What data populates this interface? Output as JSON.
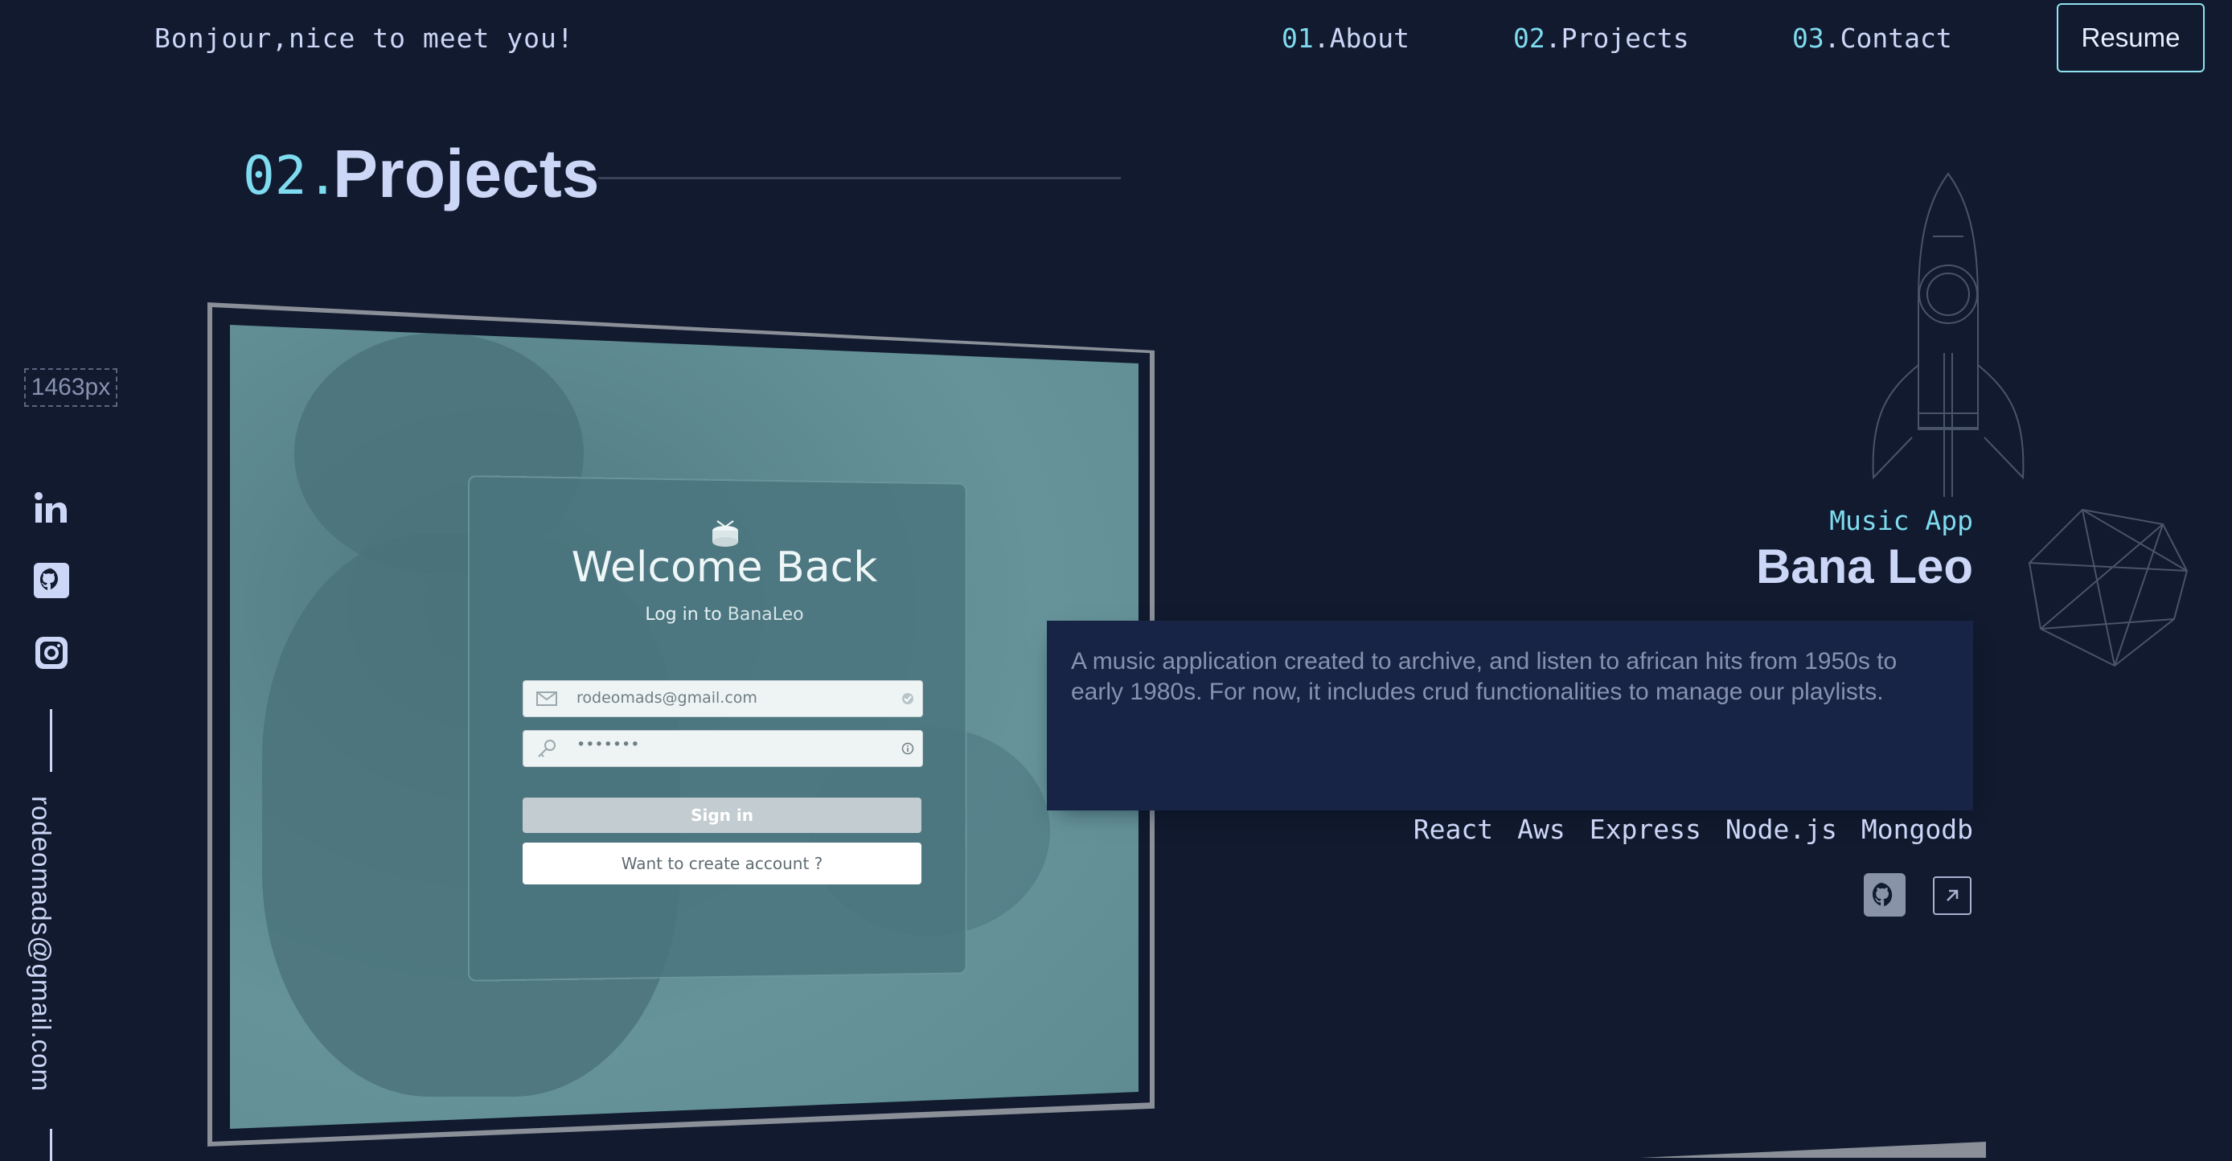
{
  "header": {
    "greeting": "Bonjour,nice to meet you!",
    "nav": [
      {
        "num": "01",
        "label": ".About"
      },
      {
        "num": "02",
        "label": ".Projects"
      },
      {
        "num": "03",
        "label": ".Contact"
      }
    ],
    "resume_label": "Resume"
  },
  "section": {
    "number": "02.",
    "title": "Projects"
  },
  "sidebar": {
    "width_indicator": "1463px",
    "email": "rodeomads@gmail.com",
    "icons": [
      "linkedin-icon",
      "github-icon",
      "instagram-icon"
    ]
  },
  "project": {
    "overline": "Music App",
    "title": "Bana Leo",
    "description": "A music application created to archive, and listen to african hits from 1950s to early 1980s. For now, it includes crud functionalities to manage our playlists.",
    "tech": [
      "React",
      "Aws",
      "Express",
      "Node.js",
      "Mongodb"
    ],
    "screenshot": {
      "welcome_title": "Welcome Back",
      "subtitle_prefix": "Log in to ",
      "subtitle_brand": "BanaLeo",
      "email_value": "rodeomads@gmail.com",
      "password_value": "•••••••",
      "signin_label": "Sign in",
      "create_account_label": "Want to create account ?"
    }
  },
  "colors": {
    "background": "#111a2e",
    "accent": "#7fdbef",
    "text": "#ccd6f6",
    "muted": "#8892b0",
    "card": "#172445"
  }
}
